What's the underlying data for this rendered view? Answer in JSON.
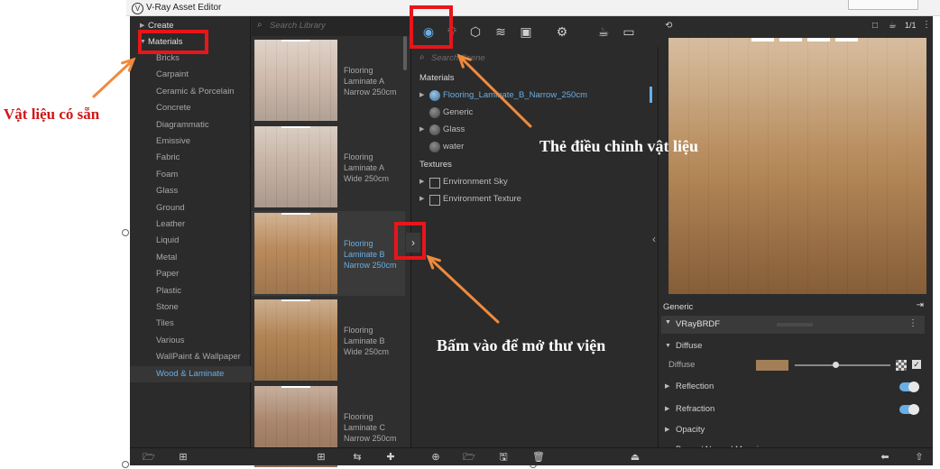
{
  "window": {
    "title": "V-Ray Asset Editor"
  },
  "categories": {
    "create": "Create",
    "materials": "Materials",
    "items": [
      "Bricks",
      "Carpaint",
      "Ceramic & Porcelain",
      "Concrete",
      "Diagrammatic",
      "Emissive",
      "Fabric",
      "Foam",
      "Glass",
      "Ground",
      "Leather",
      "Liquid",
      "Metal",
      "Paper",
      "Plastic",
      "Stone",
      "Tiles",
      "Various",
      "WallPaint & Wallpaper",
      "Wood & Laminate"
    ],
    "selected": "Wood & Laminate"
  },
  "library": {
    "search_placeholder": "Search Library",
    "items": [
      {
        "label": "Flooring Laminate A Narrow 250cm",
        "color": "#cfbcae"
      },
      {
        "label": "Flooring Laminate A Wide 250cm",
        "color": "#c7b3a5"
      },
      {
        "label": "Flooring Laminate B Narrow 250cm",
        "color": "#b98a5c"
      },
      {
        "label": "Flooring Laminate B Wide 250cm",
        "color": "#b28455"
      },
      {
        "label": "Flooring Laminate C Narrow 250cm",
        "color": "#a9856b"
      }
    ],
    "selected_index": 2
  },
  "scene": {
    "search_placeholder": "Search Scene",
    "materials_header": "Materials",
    "materials": [
      {
        "name": "Flooring_Laminate_B_Narrow_250cm",
        "expandable": true,
        "selected": true
      },
      {
        "name": "Generic",
        "expandable": false,
        "selected": false
      },
      {
        "name": "Glass",
        "expandable": true,
        "selected": false
      },
      {
        "name": "water",
        "expandable": false,
        "selected": false
      }
    ],
    "textures_header": "Textures",
    "textures": [
      "Environment Sky",
      "Environment Texture"
    ],
    "toolbar_icons": [
      "materials-icon",
      "lights-icon",
      "geometry-icon",
      "layers-icon",
      "render-elements-icon",
      "settings-icon",
      "teapot-icon",
      "frame-buffer-icon"
    ]
  },
  "preview": {
    "zoom": "1/1"
  },
  "properties": {
    "material_name": "Generic",
    "brdf": "VRayBRDF",
    "sections": [
      {
        "label": "Diffuse",
        "expanded": true,
        "toggle": false
      },
      {
        "label": "Reflection",
        "expanded": false,
        "toggle": true
      },
      {
        "label": "Refraction",
        "expanded": false,
        "toggle": true
      },
      {
        "label": "Opacity",
        "expanded": false,
        "toggle": false
      }
    ],
    "diffuse_label": "Diffuse",
    "diffuse_color": "#a27f56",
    "diffuse_amount": 0.42,
    "partial_next": "Bump / Normal Mapping"
  },
  "annotations": {
    "left_text": "Vật liệu có sẵn",
    "middle_text": "Bấm vào để mở thư viện",
    "right_text": "Thẻ điều chỉnh vật liệu",
    "arrow_color": "#f08a3c",
    "box_color": "#e8151b"
  }
}
